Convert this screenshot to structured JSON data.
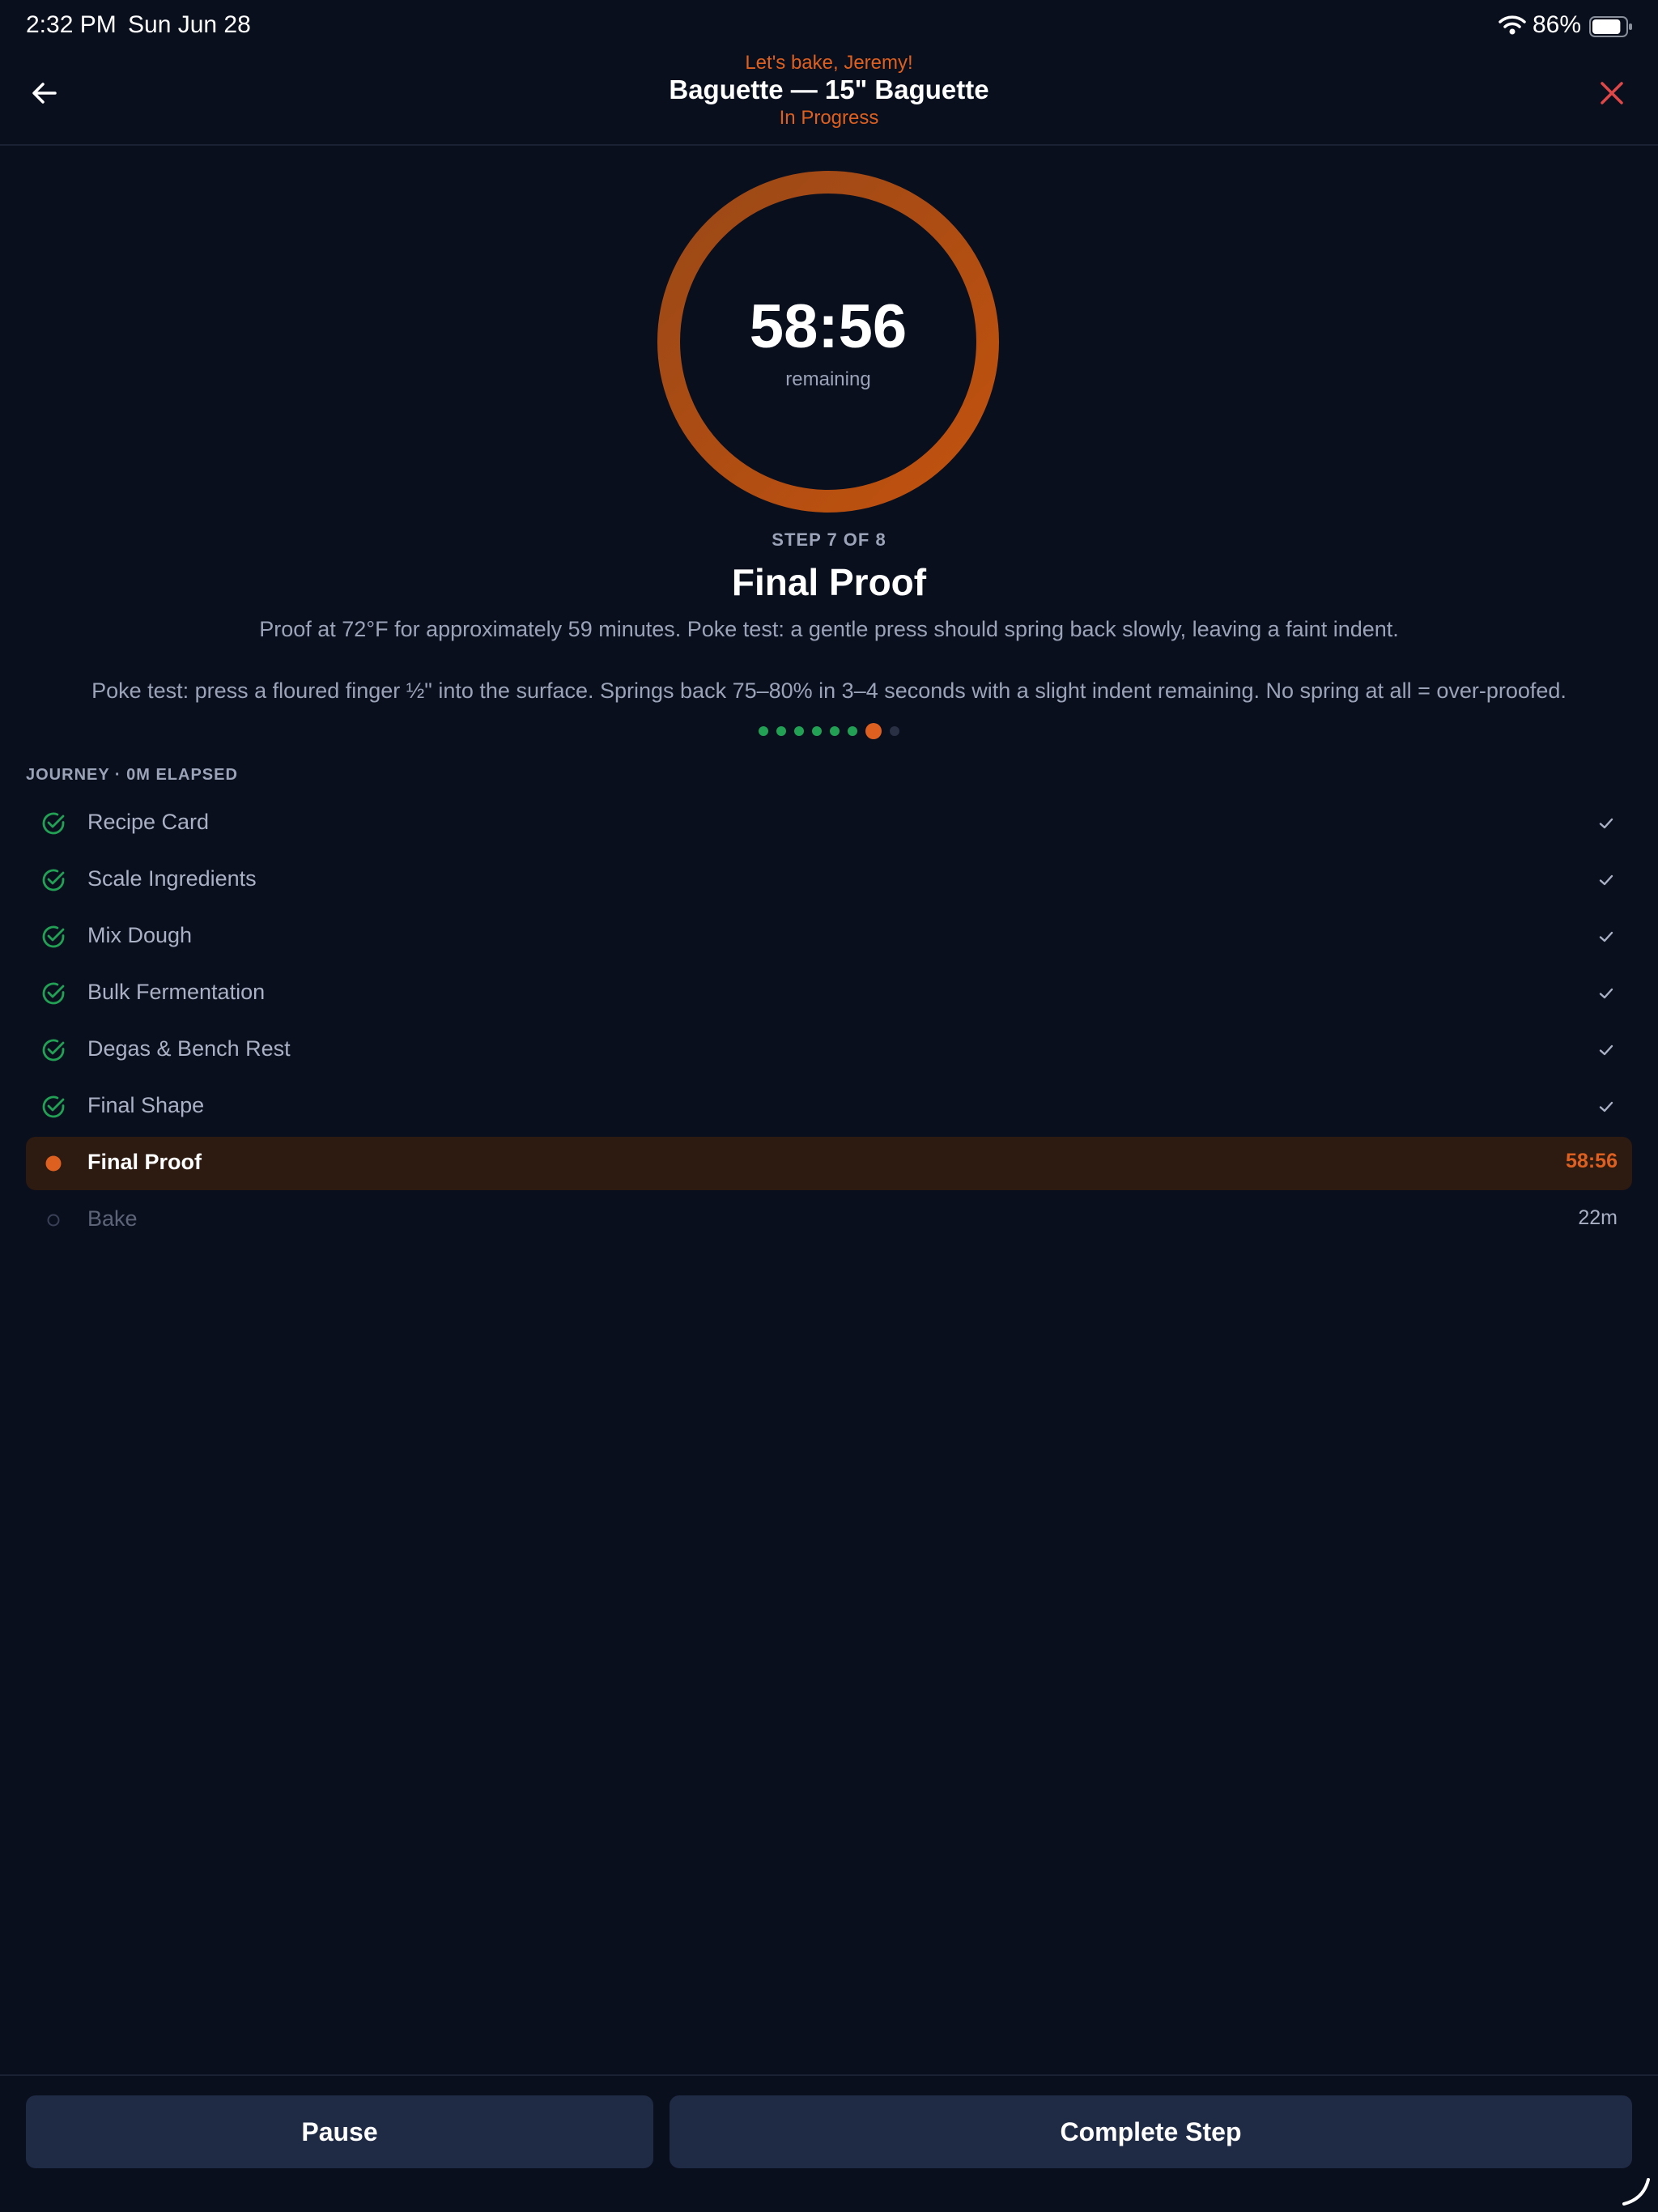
{
  "status_bar": {
    "time": "2:32 PM",
    "date": "Sun Jun 28",
    "battery_percent": "86%",
    "battery_level": 0.86
  },
  "header": {
    "greeting": "Let's bake, Jeremy!",
    "title": "Baguette — 15\" Baguette",
    "status": "In Progress"
  },
  "timer": {
    "value": "58:56",
    "label": "remaining"
  },
  "step": {
    "counter": "STEP 7 OF 8",
    "title": "Final Proof",
    "description": "Proof at 72°F for approximately 59 minutes. Poke test: a gentle press should spring back slowly, leaving a faint indent.",
    "tip": "Poke test: press a floured finger ½\" into the surface. Springs back 75–80% in 3–4 seconds with a slight indent remaining. No spring at all = over-proofed."
  },
  "progress_dots": [
    "done",
    "done",
    "done",
    "done",
    "done",
    "done",
    "current",
    "pending"
  ],
  "journey": {
    "label": "JOURNEY · 0M ELAPSED",
    "steps": [
      {
        "label": "Recipe Card",
        "state": "done",
        "right": ""
      },
      {
        "label": "Scale Ingredients",
        "state": "done",
        "right": ""
      },
      {
        "label": "Mix Dough",
        "state": "done",
        "right": ""
      },
      {
        "label": "Bulk Fermentation",
        "state": "done",
        "right": ""
      },
      {
        "label": "Degas & Bench Rest",
        "state": "done",
        "right": ""
      },
      {
        "label": "Final Shape",
        "state": "done",
        "right": ""
      },
      {
        "label": "Final Proof",
        "state": "active",
        "right": "58:56"
      },
      {
        "label": "Bake",
        "state": "pending",
        "right": "22m"
      }
    ]
  },
  "buttons": {
    "pause": "Pause",
    "complete": "Complete Step"
  },
  "colors": {
    "background": "#0a0f1e",
    "accent": "#dd6020",
    "success": "#22a155",
    "button": "#1f2a44",
    "muted": "#9ba3b8"
  },
  "icons": {
    "back": "arrow-left-icon",
    "close": "close-icon",
    "done": "check-circle-icon",
    "active": "filled-dot-icon",
    "pending": "hollow-circle-icon",
    "row_check": "checkmark-icon"
  }
}
